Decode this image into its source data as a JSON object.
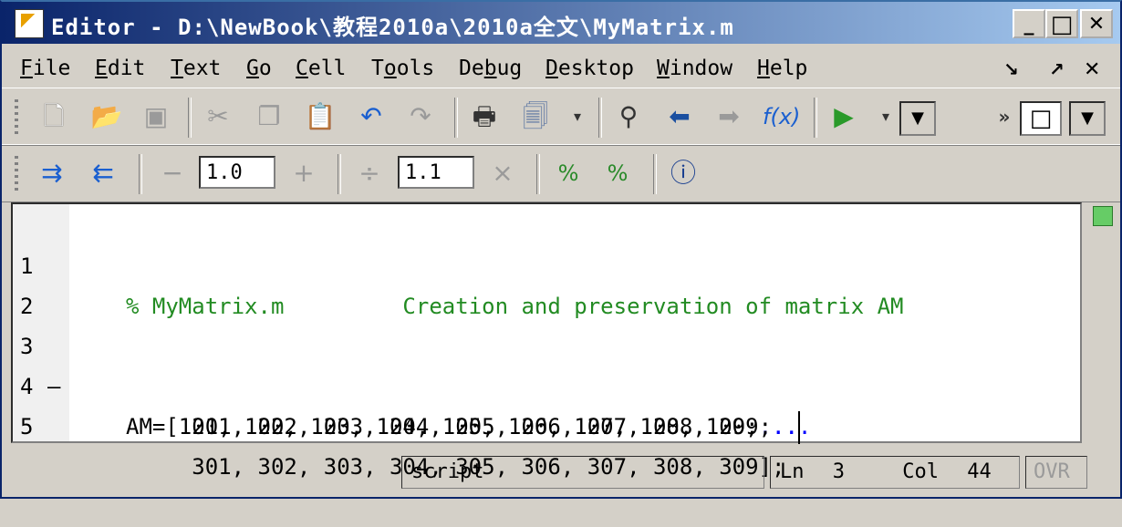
{
  "window": {
    "title": "Editor - D:\\NewBook\\教程2010a\\2010a全文\\MyMatrix.m",
    "controls": {
      "minimize": "_",
      "maximize": "□",
      "close": "✕"
    }
  },
  "menu": {
    "items": [
      {
        "label": "File",
        "hotkey": "F"
      },
      {
        "label": "Edit",
        "hotkey": "E"
      },
      {
        "label": "Text",
        "hotkey": "T"
      },
      {
        "label": "Go",
        "hotkey": "G"
      },
      {
        "label": "Cell",
        "hotkey": "C"
      },
      {
        "label": "Tools",
        "hotkey": "o"
      },
      {
        "label": "Debug",
        "hotkey": "b"
      },
      {
        "label": "Desktop",
        "hotkey": "D"
      },
      {
        "label": "Window",
        "hotkey": "W"
      },
      {
        "label": "Help",
        "hotkey": "H"
      }
    ],
    "dock_icons": {
      "undock": "↘",
      "undock2": "↗",
      "close": "✕"
    }
  },
  "toolbar1": {
    "icons": [
      "new-file-icon",
      "open-file-icon",
      "save-icon",
      "cut-icon",
      "copy-icon",
      "paste-icon",
      "undo-icon",
      "redo-icon",
      "print-icon",
      "print-options-icon",
      "find-icon",
      "back-arrow-icon",
      "forward-arrow-icon",
      "function-icon",
      "run-icon",
      "stack-dropdown",
      "layout-icon"
    ]
  },
  "toolbar2": {
    "decrement_value": "1.0",
    "divide_value": "1.1",
    "minus_symbol": "−",
    "plus_symbol": "+",
    "divide_symbol": "÷",
    "times_symbol": "×"
  },
  "editor": {
    "lines": [
      {
        "number": "1",
        "marker": "",
        "comment": "% MyMatrix.m         Creation and preservation of matrix AM",
        "code": "",
        "cont": ""
      },
      {
        "number": "2",
        "marker": "",
        "comment": "",
        "code": "",
        "cont": ""
      },
      {
        "number": "3",
        "marker": "—",
        "comment": "",
        "code": "AM=[101, 102, 103, 104, 105, 106, 107, 108, 109;",
        "cont": "..."
      },
      {
        "number": "4",
        "marker": "",
        "comment": "",
        "code": "     201, 202, 203, 204, 205, 206, 207, 208, 209;",
        "cont": "..."
      },
      {
        "number": "5",
        "marker": "",
        "comment": "",
        "code": "     301, 302, 303, 304, 305, 306, 307, 308, 309];",
        "cont": ""
      }
    ]
  },
  "status": {
    "mode": "script",
    "ln_label": "Ln",
    "ln_value": "3",
    "col_label": "Col",
    "col_value": "44",
    "ovr": "OVR"
  }
}
